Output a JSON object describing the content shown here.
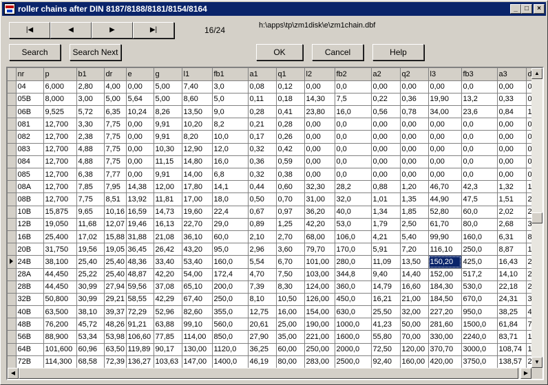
{
  "window": {
    "title": "roller chains after DIN 8187/8188/8181/8154/8164",
    "minimize": "_",
    "maximize": "□",
    "close": "×"
  },
  "nav": {
    "first": "|◀",
    "prev": "◀",
    "next": "▶",
    "last": "▶|",
    "record": "16/24",
    "path": "h:\\apps\\tp\\zm1disk\\e\\zm1chain.dbf"
  },
  "buttons": {
    "search": "Search",
    "search_next": "Search Next",
    "ok": "OK",
    "cancel": "Cancel",
    "help": "Help"
  },
  "grid": {
    "columns": [
      "nr",
      "p",
      "b1",
      "dr",
      "e",
      "g",
      "l1",
      "fb1",
      "a1",
      "q1",
      "l2",
      "fb2",
      "a2",
      "q2",
      "l3",
      "fb3",
      "a3",
      "d"
    ],
    "current_row": 15,
    "current_col": 14,
    "rows": [
      [
        "04",
        "6,000",
        "2,80",
        "4,00",
        "0,00",
        "5,00",
        "7,40",
        "3,0",
        "0,08",
        "0,12",
        "0,00",
        "0,0",
        "0,00",
        "0,00",
        "0,00",
        "0,0",
        "0,00",
        "0"
      ],
      [
        "05B",
        "8,000",
        "3,00",
        "5,00",
        "5,64",
        "5,00",
        "8,60",
        "5,0",
        "0,11",
        "0,18",
        "14,30",
        "7,5",
        "0,22",
        "0,36",
        "19,90",
        "13,2",
        "0,33",
        "0"
      ],
      [
        "06B",
        "9,525",
        "5,72",
        "6,35",
        "10,24",
        "8,26",
        "13,50",
        "9,0",
        "0,28",
        "0,41",
        "23,80",
        "16,0",
        "0,56",
        "0,78",
        "34,00",
        "23,6",
        "0,84",
        "1"
      ],
      [
        "081",
        "12,700",
        "3,30",
        "7,75",
        "0,00",
        "9,91",
        "10,20",
        "8,2",
        "0,21",
        "0,28",
        "0,00",
        "0,0",
        "0,00",
        "0,00",
        "0,00",
        "0,0",
        "0,00",
        "0"
      ],
      [
        "082",
        "12,700",
        "2,38",
        "7,75",
        "0,00",
        "9,91",
        "8,20",
        "10,0",
        "0,17",
        "0,26",
        "0,00",
        "0,0",
        "0,00",
        "0,00",
        "0,00",
        "0,0",
        "0,00",
        "0"
      ],
      [
        "083",
        "12,700",
        "4,88",
        "7,75",
        "0,00",
        "10,30",
        "12,90",
        "12,0",
        "0,32",
        "0,42",
        "0,00",
        "0,0",
        "0,00",
        "0,00",
        "0,00",
        "0,0",
        "0,00",
        "0"
      ],
      [
        "084",
        "12,700",
        "4,88",
        "7,75",
        "0,00",
        "11,15",
        "14,80",
        "16,0",
        "0,36",
        "0,59",
        "0,00",
        "0,0",
        "0,00",
        "0,00",
        "0,00",
        "0,0",
        "0,00",
        "0"
      ],
      [
        "085",
        "12,700",
        "6,38",
        "7,77",
        "0,00",
        "9,91",
        "14,00",
        "6,8",
        "0,32",
        "0,38",
        "0,00",
        "0,0",
        "0,00",
        "0,00",
        "0,00",
        "0,0",
        "0,00",
        "0"
      ],
      [
        "08A",
        "12,700",
        "7,85",
        "7,95",
        "14,38",
        "12,00",
        "17,80",
        "14,1",
        "0,44",
        "0,60",
        "32,30",
        "28,2",
        "0,88",
        "1,20",
        "46,70",
        "42,3",
        "1,32",
        "1"
      ],
      [
        "08B",
        "12,700",
        "7,75",
        "8,51",
        "13,92",
        "11,81",
        "17,00",
        "18,0",
        "0,50",
        "0,70",
        "31,00",
        "32,0",
        "1,01",
        "1,35",
        "44,90",
        "47,5",
        "1,51",
        "2"
      ],
      [
        "10B",
        "15,875",
        "9,65",
        "10,16",
        "16,59",
        "14,73",
        "19,60",
        "22,4",
        "0,67",
        "0,97",
        "36,20",
        "40,0",
        "1,34",
        "1,85",
        "52,80",
        "60,0",
        "2,02",
        "2"
      ],
      [
        "12B",
        "19,050",
        "11,68",
        "12,07",
        "19,46",
        "16,13",
        "22,70",
        "29,0",
        "0,89",
        "1,25",
        "42,20",
        "53,0",
        "1,79",
        "2,50",
        "61,70",
        "80,0",
        "2,68",
        "3"
      ],
      [
        "16B",
        "25,400",
        "17,02",
        "15,88",
        "31,88",
        "21,08",
        "36,10",
        "60,0",
        "2,10",
        "2,70",
        "68,00",
        "106,0",
        "4,21",
        "5,40",
        "99,90",
        "160,0",
        "6,31",
        "8"
      ],
      [
        "20B",
        "31,750",
        "19,56",
        "19,05",
        "36,45",
        "26,42",
        "43,20",
        "95,0",
        "2,96",
        "3,60",
        "79,70",
        "170,0",
        "5,91",
        "7,20",
        "116,10",
        "250,0",
        "8,87",
        "1"
      ],
      [
        "24B",
        "38,100",
        "25,40",
        "25,40",
        "48,36",
        "33,40",
        "53,40",
        "160,0",
        "5,54",
        "6,70",
        "101,00",
        "280,0",
        "11,09",
        "13,50",
        "150,20",
        "425,0",
        "16,43",
        "2"
      ],
      [
        "28A",
        "44,450",
        "25,22",
        "25,40",
        "48,87",
        "42,20",
        "54,00",
        "172,4",
        "4,70",
        "7,50",
        "103,00",
        "344,8",
        "9,40",
        "14,40",
        "152,00",
        "517,2",
        "14,10",
        "2"
      ],
      [
        "28B",
        "44,450",
        "30,99",
        "27,94",
        "59,56",
        "37,08",
        "65,10",
        "200,0",
        "7,39",
        "8,30",
        "124,00",
        "360,0",
        "14,79",
        "16,60",
        "184,30",
        "530,0",
        "22,18",
        "2"
      ],
      [
        "32B",
        "50,800",
        "30,99",
        "29,21",
        "58,55",
        "42,29",
        "67,40",
        "250,0",
        "8,10",
        "10,50",
        "126,00",
        "450,0",
        "16,21",
        "21,00",
        "184,50",
        "670,0",
        "24,31",
        "3"
      ],
      [
        "40B",
        "63,500",
        "38,10",
        "39,37",
        "72,29",
        "52,96",
        "82,60",
        "355,0",
        "12,75",
        "16,00",
        "154,00",
        "630,0",
        "25,50",
        "32,00",
        "227,20",
        "950,0",
        "38,25",
        "4"
      ],
      [
        "48B",
        "76,200",
        "45,72",
        "48,26",
        "91,21",
        "63,88",
        "99,10",
        "560,0",
        "20,61",
        "25,00",
        "190,00",
        "1000,0",
        "41,23",
        "50,00",
        "281,60",
        "1500,0",
        "61,84",
        "7"
      ],
      [
        "56B",
        "88,900",
        "53,34",
        "53,98",
        "106,60",
        "77,85",
        "114,00",
        "850,0",
        "27,90",
        "35,00",
        "221,00",
        "1600,0",
        "55,80",
        "70,00",
        "330,00",
        "2240,0",
        "83,71",
        "1"
      ],
      [
        "64B",
        "101,600",
        "60,96",
        "63,50",
        "119,89",
        "90,17",
        "130,00",
        "1120,0",
        "36,25",
        "60,00",
        "250,00",
        "2000,0",
        "72,50",
        "120,00",
        "370,70",
        "3000,0",
        "108,74",
        "1"
      ],
      [
        "72B",
        "114,300",
        "68,58",
        "72,39",
        "136,27",
        "103,63",
        "147,00",
        "1400,0",
        "46,19",
        "80,00",
        "283,00",
        "2500,0",
        "92,40",
        "160,00",
        "420,00",
        "3750,0",
        "138,57",
        "2"
      ]
    ]
  },
  "scroll": {
    "up": "▲",
    "down": "▼",
    "left": "◀",
    "right": "▶"
  }
}
